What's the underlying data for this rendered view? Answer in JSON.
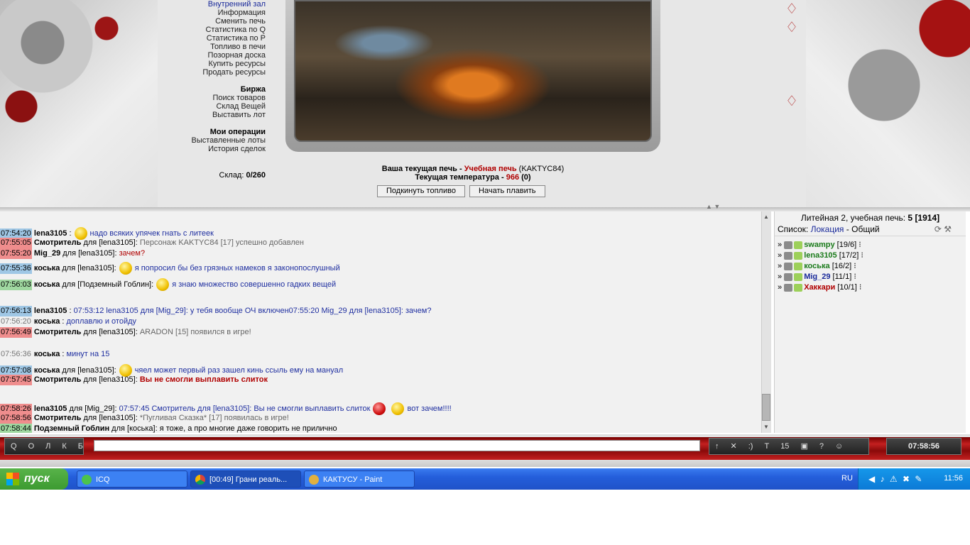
{
  "menu": {
    "items_a": [
      "Внутренний зал",
      "Информация",
      "Сменить печь",
      "Статистика по Q",
      "Статистика по P",
      "Топливо в печи",
      "Позорная доска",
      "Купить ресурсы",
      "Продать ресурсы"
    ],
    "exchange_title": "Биржа",
    "items_b": [
      "Поиск товаров",
      "Склад Вещей",
      "Выставить лот"
    ],
    "ops_title": "Мои операции",
    "items_c": [
      "Выставленные лоты",
      "История сделок"
    ],
    "stock_label": "Склад:",
    "stock_value": "0/260"
  },
  "furnace": {
    "current_label": "Ваша текущая печь -",
    "current_name": "Учебная печь",
    "owner": "(KAKTYC84)",
    "temp_label": "Текущая температура -",
    "temp_value": "966",
    "temp_extra": "(0)",
    "btn_fuel": "Подкинуть топливо",
    "btn_smelt": "Начать плавить"
  },
  "chat": {
    "messages": [
      {
        "time": "07:54:20",
        "tc": "t-blue",
        "nick": "lena3105",
        "target": "",
        "smile": true,
        "text": "надо всяких упячек гнать с литеек",
        "cls": "mtext"
      },
      {
        "time": "07:55:05",
        "tc": "t-red",
        "nick": "Смотритель",
        "target": "для [lena3105]:",
        "smile": false,
        "text": "Персонаж KAKTYC84 [17] успешно добавлен",
        "cls": "sys"
      },
      {
        "time": "07:55:20",
        "tc": "t-red",
        "nick": "Mig_29",
        "target": "для [lena3105]:",
        "smile": false,
        "text": "зачем?",
        "cls": "warn-plain"
      },
      {
        "time": "07:55:36",
        "tc": "t-blue",
        "nick": "коська",
        "target": "для [lena3105]:",
        "smile": true,
        "text": "я попросил бы без грязных намеков я законопослушный",
        "cls": "mtext"
      },
      {
        "time": "07:56:03",
        "tc": "t-green",
        "nick": "коська",
        "target": "для [Подземный Гоблин]:",
        "smile": true,
        "text": "я знаю множество совершенно гадких вещей",
        "cls": "mtext"
      },
      {
        "time": "07:56:13",
        "tc": "t-blue",
        "nick": "lena3105",
        "target": "",
        "smile": false,
        "text": "07:53:12 lena3105 для [Mig_29]: у тебя вообще ОЧ включен07:55:20 Mig_29 для [lena3105]: зачем?",
        "cls": "mtext"
      },
      {
        "time": "07:56:20",
        "tc": "t-none",
        "nick": "коська",
        "target": "",
        "smile": false,
        "text": "доплавлю и отойду",
        "cls": "mtext"
      },
      {
        "time": "07:56:49",
        "tc": "t-red",
        "nick": "Смотритель",
        "target": "для [lena3105]:",
        "smile": false,
        "text": "ARADON [15] появился в игре!",
        "cls": "sys"
      },
      {
        "time": "07:56:36",
        "tc": "t-none",
        "nick": "коська",
        "target": "",
        "smile": false,
        "text": "минут на 15",
        "cls": "mtext"
      },
      {
        "time": "07:57:08",
        "tc": "t-blue",
        "nick": "коська",
        "target": "для [lena3105]:",
        "smile": true,
        "text": "чяел может первый раз зашел кинь ссыль ему на мануал",
        "cls": "mtext"
      },
      {
        "time": "07:57:45",
        "tc": "t-red",
        "nick": "Смотритель",
        "target": "для [lena3105]:",
        "smile": false,
        "text": "Вы не смогли выплавить слиток",
        "cls": "warn"
      },
      {
        "time": "07:58:26",
        "tc": "t-red",
        "nick": "lena3105",
        "target": "для [Mig_29]:",
        "smile": false,
        "text": "07:57:45 Смотритель для [lena3105]: Вы не смогли выплавить слиток",
        "cls": "mtext",
        "tail": "вот зачем!!!!"
      },
      {
        "time": "07:58:56",
        "tc": "t-red",
        "nick": "Смотритель",
        "target": "для [lena3105]:",
        "smile": false,
        "text": "*Пугливая Сказка* [17] появилась в игре!",
        "cls": "sys"
      },
      {
        "time": "07:58:44",
        "tc": "t-green",
        "nick": "Подземный Гоблин",
        "target": "для [коська]:",
        "smile": false,
        "text": "я тоже, а про многие даже говорить не прилично",
        "cls": "plain"
      }
    ]
  },
  "side": {
    "title": "Литейная 2, учебная печь:",
    "count": "5",
    "total": "[1914]",
    "list_label": "Список:",
    "list_link": "Локация",
    "list_sep": "-",
    "list_general": "Общий",
    "users": [
      {
        "name": "swampy",
        "level": "[19/6]",
        "color": "#1a7a1a"
      },
      {
        "name": "lena3105",
        "level": "[17/2]",
        "color": "#1a7a1a"
      },
      {
        "name": "коська",
        "level": "[16/2]",
        "color": "#1a7a1a"
      },
      {
        "name": "Mig_29",
        "level": "[11/1]",
        "color": "#1a2a9a"
      },
      {
        "name": "Хаккари",
        "level": "[10/1]",
        "color": "#b00000"
      }
    ]
  },
  "bar": {
    "left_buttons": [
      "Q",
      "О",
      "Л",
      "К",
      "Б"
    ],
    "right_buttons": [
      "↑",
      "✕",
      ":)",
      "T",
      "15",
      "▣",
      "?",
      "☺"
    ],
    "clock": "07:58:56"
  },
  "taskbar": {
    "start": "пуск",
    "tasks": [
      "ICQ",
      "[00:49] Грани реаль...",
      "КАКТУСУ - Paint"
    ],
    "lang": "RU",
    "time": "11:56"
  }
}
